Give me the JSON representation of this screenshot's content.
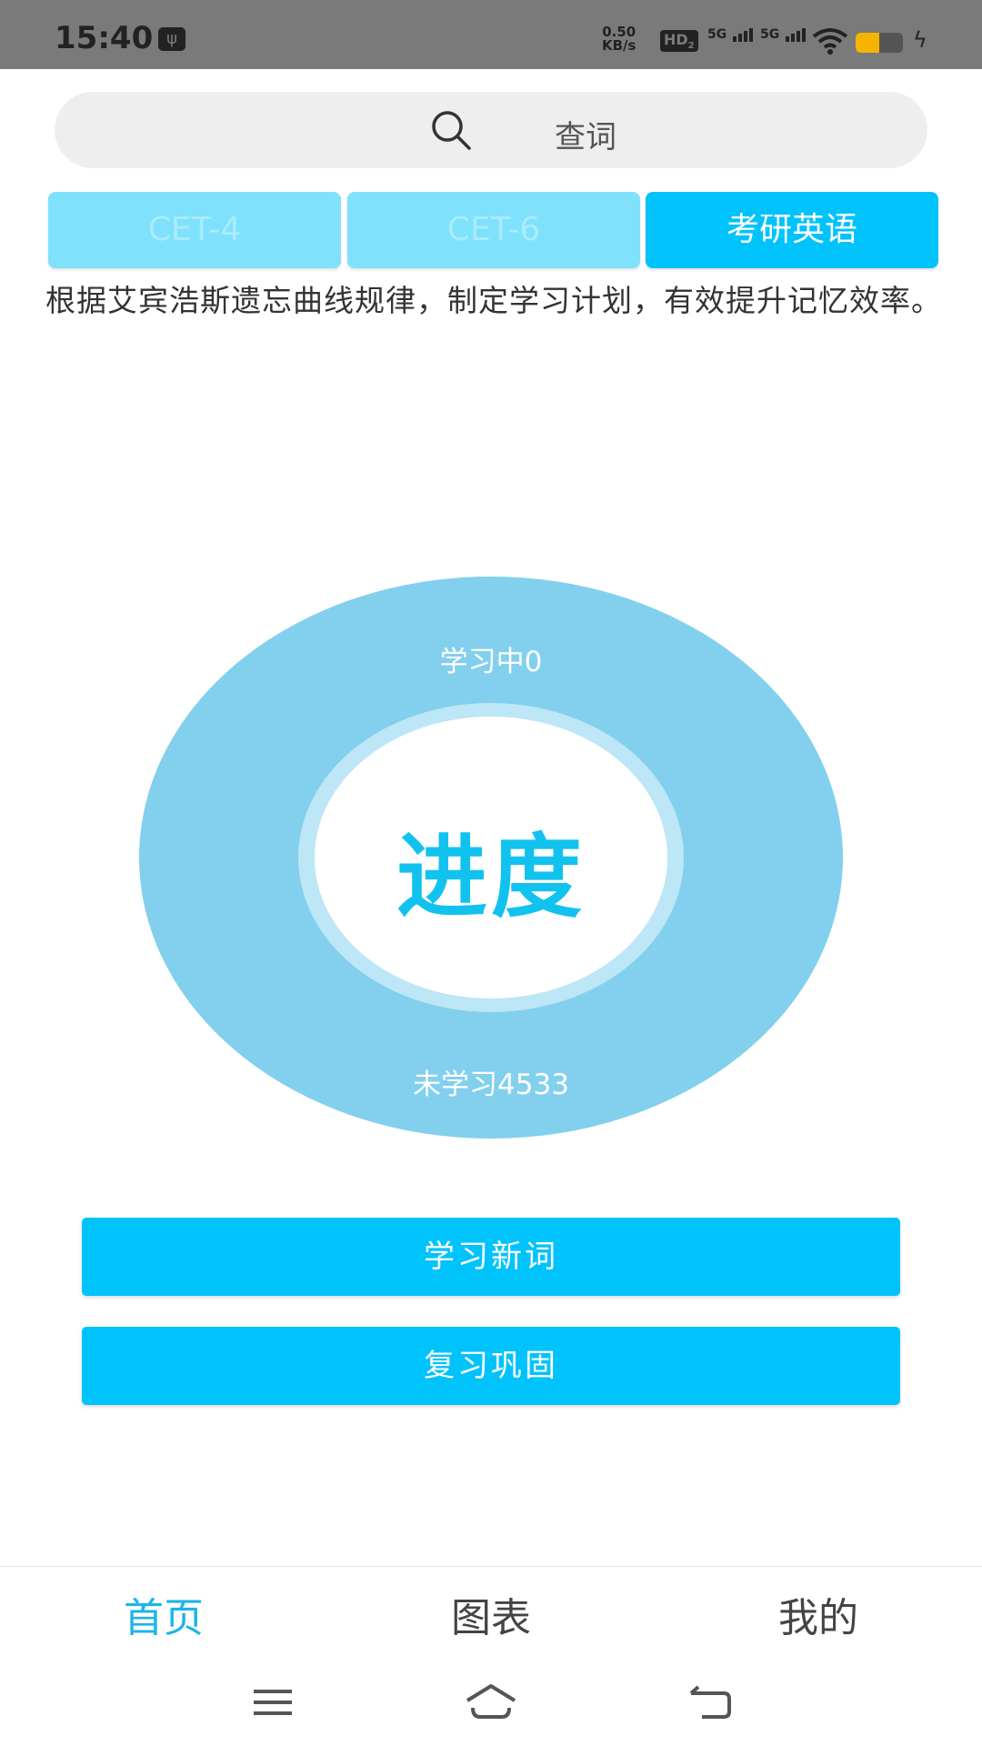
{
  "status_bar": {
    "time": "15:40",
    "net_speed_value": "0.50",
    "net_speed_unit": "KB/s",
    "hd_label": "HD",
    "hd_sub": "2",
    "signal1_label": "5G",
    "signal2_label": "5G"
  },
  "search": {
    "placeholder": "查词"
  },
  "tabs": [
    {
      "label": "CET-4",
      "active": false
    },
    {
      "label": "CET-6",
      "active": false
    },
    {
      "label": "考研英语",
      "active": true
    }
  ],
  "description": "根据艾宾浩斯遗忘曲线规律，制定学习计划，有效提升记忆效率。",
  "progress": {
    "center_label": "进度",
    "learning_label": "学习中0",
    "unlearned_label": "未学习4533",
    "learning_count": 0,
    "unlearned_count": 4533
  },
  "actions": {
    "learn_new": "学习新词",
    "review": "复习巩固"
  },
  "bottom_nav": [
    {
      "label": "首页",
      "selected": true
    },
    {
      "label": "图表",
      "selected": false
    },
    {
      "label": "我的",
      "selected": false
    }
  ],
  "colors": {
    "accent": "#00c3fc",
    "tab_inactive": "#7fe1fb",
    "donut_outer": "#82d0ed",
    "donut_inner_ring": "#bde6f6",
    "nav_selected": "#1cb5e6"
  },
  "icons": {
    "search": "search-icon",
    "menu": "menu-icon",
    "home": "home-icon",
    "back": "back-icon"
  }
}
